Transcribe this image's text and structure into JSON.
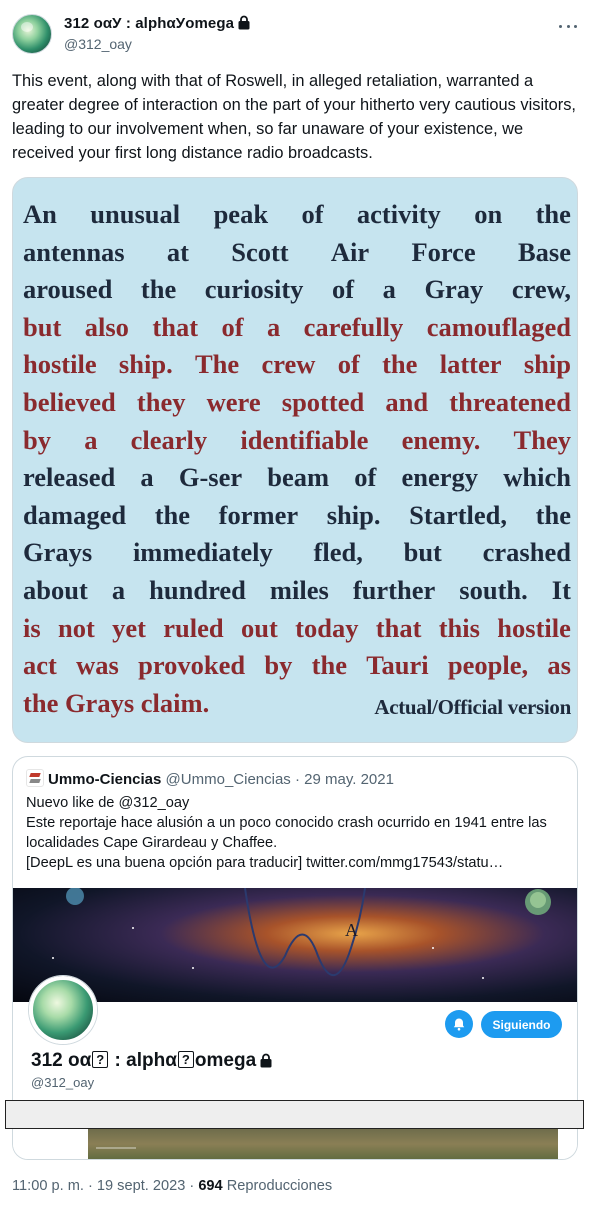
{
  "author": {
    "display_name": "312 οαУ : alphαУomega",
    "handle": "@312_oay"
  },
  "tweet": {
    "text": "This event, along with that of Roswell, in alleged retaliation, warranted a greater degree of interaction on the part of your hitherto very cautious visitors, leading to our involvement when, so far unaware of your existence, we received your first long distance radio broadcasts."
  },
  "media_text": {
    "lines": [
      {
        "t": "An unusual peak of activity on the",
        "red": false
      },
      {
        "t": "antennas at Scott Air Force Base",
        "red": false
      },
      {
        "t": "aroused the curiosity of a Gray crew,",
        "red": false
      },
      {
        "t": "but also that of a carefully camouflaged",
        "red": true
      },
      {
        "t": "hostile ship. The crew of the latter ship",
        "red": true
      },
      {
        "t": "believed they were spotted and threatened",
        "red": true
      },
      {
        "t": "by a clearly identifiable enemy. They",
        "red": true
      },
      {
        "t": "released a G-ser beam of energy which",
        "red": false
      },
      {
        "t": "damaged the former ship. Startled, the",
        "red": false
      },
      {
        "t": "Grays immediately fled, but crashed",
        "red": false
      },
      {
        "t": "about a hundred miles further south. It",
        "red": false
      },
      {
        "t": "is not yet ruled out today that this hostile",
        "red": true
      },
      {
        "t": "act was provoked by the Tauri people, as",
        "red": true
      }
    ],
    "last_line": "the Grays claim.",
    "credit": "Actual/Official version"
  },
  "quote": {
    "name": "Ummo-Ciencias",
    "handle": "@Ummo_Ciencias",
    "date": "29 may. 2021",
    "line1": "Nuevo like de @312_oay",
    "line2": "Este reportaje hace alusión a un poco conocido crash ocurrido en 1941 entre las localidades Cape Girardeau y Chaffee.",
    "line3": "[DeepL es una buena opción para traducir]  twitter.com/mmg17543/statu…",
    "profile": {
      "name_part1": "312 οα",
      "glyph": "?",
      "name_part2": " : alphα",
      "name_part3": "omega",
      "handle": "@312_oay",
      "follow_label": "Siguiendo"
    }
  },
  "footer": {
    "time_date": "11:00 p. m. · 19 sept. 2023 · ",
    "views": "694",
    "views_label": " Reproducciones"
  },
  "colors": {
    "accent": "#1d9bf0",
    "muted": "#536471",
    "scan_bg": "#c6e4ef",
    "scan_red": "#8a2a2e"
  }
}
